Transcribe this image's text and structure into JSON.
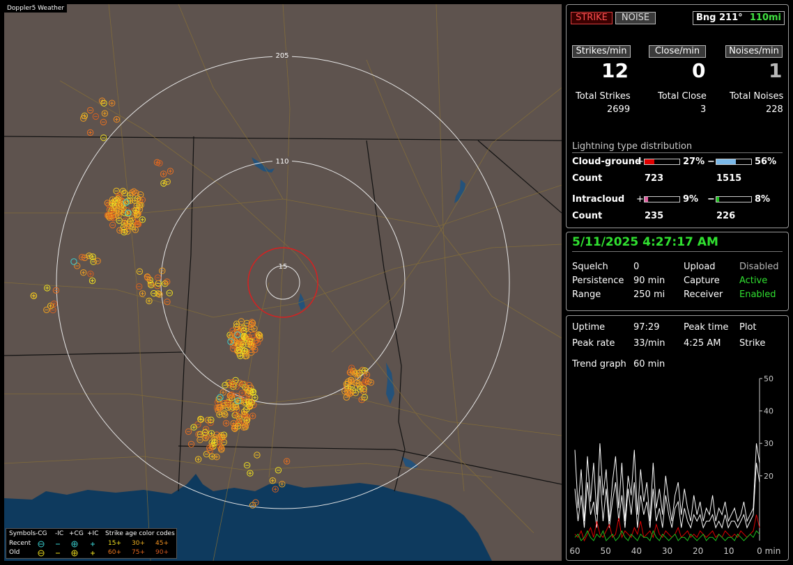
{
  "map": {
    "title": "Doppler5 Weather",
    "range_labels": [
      "205",
      "110",
      "15"
    ],
    "legend": {
      "symbols_label": "Symbols",
      "col_headers": [
        "-CG",
        "-IC",
        "+CG",
        "+IC"
      ],
      "rows": [
        "Recent",
        "Old"
      ],
      "age_title": "Strike age color codes",
      "age_codes": [
        [
          "15+",
          "30+",
          "45+"
        ],
        [
          "60+",
          "75+",
          "90+"
        ]
      ]
    }
  },
  "top": {
    "strike_label": "STRIKE",
    "noise_label": "NOISE",
    "bearing_label": "Bng 211°",
    "distance_label": "110mi",
    "strikes_min_label": "Strikes/min",
    "close_min_label": "Close/min",
    "noises_min_label": "Noises/min",
    "strikes_min": "12",
    "close_min": "0",
    "noises_min": "1",
    "total_strikes_label": "Total Strikes",
    "total_close_label": "Total Close",
    "total_noises_label": "Total Noises",
    "total_strikes": "2699",
    "total_close": "3",
    "total_noises": "228",
    "dist_title": "Lightning type distribution",
    "cg_label": "Cloud-ground",
    "ic_label": "Intracloud",
    "count_label": "Count",
    "plus": "+",
    "minus": "−",
    "cg_pos_pct": "27%",
    "cg_neg_pct": "56%",
    "cg_pos_count": "723",
    "cg_neg_count": "1515",
    "ic_pos_pct": "9%",
    "ic_neg_pct": "8%",
    "ic_pos_count": "235",
    "ic_neg_count": "226",
    "cg_pos_frac": 0.27,
    "cg_neg_frac": 0.56,
    "ic_pos_frac": 0.09,
    "ic_neg_frac": 0.08,
    "colors": {
      "cg_pos": "#e00000",
      "cg_neg": "#7ab8e8",
      "ic_pos": "#e060a0",
      "ic_neg": "#20c020"
    }
  },
  "status": {
    "datetime": "5/11/2025 4:27:17 AM",
    "squelch_label": "Squelch",
    "squelch": "0",
    "persistence_label": "Persistence",
    "persistence": "90 min",
    "range_label": "Range",
    "range": "250 mi",
    "upload_label": "Upload",
    "upload": "Disabled",
    "capture_label": "Capture",
    "capture": "Active",
    "receiver_label": "Receiver",
    "receiver": "Enabled"
  },
  "stats": {
    "uptime_label": "Uptime",
    "uptime": "97:29",
    "peak_time_label": "Peak time",
    "peak_time": "4:25 AM",
    "plot_label": "Plot",
    "plot": "Strike",
    "peak_rate_label": "Peak rate",
    "peak_rate": "33/min",
    "trend_label": "Trend graph",
    "trend": "60 min"
  },
  "chart_data": {
    "type": "line",
    "xlabel": "min",
    "x_ticks": [
      "60",
      "50",
      "40",
      "30",
      "20",
      "10",
      "0"
    ],
    "y_ticks": [
      "50",
      "40",
      "30",
      "20"
    ],
    "ylim": [
      0,
      50
    ],
    "xlim": [
      60,
      0
    ],
    "series": [
      {
        "color": "#ffffff",
        "values": [
          28,
          10,
          22,
          6,
          26,
          12,
          24,
          8,
          30,
          14,
          22,
          6,
          18,
          26,
          10,
          24,
          6,
          20,
          14,
          28,
          8,
          22,
          12,
          18,
          6,
          24,
          10,
          16,
          8,
          20,
          12,
          6,
          14,
          18,
          8,
          16,
          10,
          6,
          14,
          8,
          12,
          6,
          10,
          8,
          14,
          6,
          10,
          8,
          12,
          6,
          8,
          10,
          6,
          8,
          12,
          6,
          8,
          10,
          30,
          24
        ]
      },
      {
        "color": "#ffffff",
        "values": [
          16,
          6,
          14,
          4,
          18,
          8,
          12,
          4,
          20,
          6,
          16,
          4,
          12,
          18,
          6,
          14,
          4,
          16,
          8,
          18,
          4,
          14,
          8,
          12,
          4,
          16,
          6,
          10,
          4,
          14,
          8,
          4,
          10,
          12,
          4,
          10,
          6,
          4,
          8,
          6,
          8,
          4,
          6,
          6,
          8,
          4,
          6,
          4,
          8,
          4,
          6,
          6,
          4,
          6,
          8,
          4,
          6,
          8,
          24,
          18
        ]
      },
      {
        "color": "#e00000",
        "values": [
          2,
          1,
          3,
          0,
          2,
          4,
          1,
          6,
          2,
          1,
          3,
          5,
          1,
          2,
          7,
          1,
          3,
          2,
          1,
          4,
          2,
          6,
          1,
          2,
          3,
          1,
          5,
          2,
          1,
          3,
          2,
          1,
          2,
          4,
          1,
          2,
          3,
          1,
          2,
          1,
          3,
          2,
          1,
          2,
          3,
          1,
          2,
          1,
          3,
          2,
          1,
          2,
          1,
          3,
          2,
          1,
          2,
          3,
          8,
          4
        ]
      },
      {
        "color": "#20c020",
        "values": [
          1,
          2,
          0,
          1,
          3,
          1,
          0,
          2,
          1,
          3,
          0,
          1,
          2,
          0,
          1,
          3,
          1,
          0,
          2,
          1,
          0,
          2,
          1,
          1,
          0,
          3,
          1,
          0,
          2,
          1,
          0,
          1,
          2,
          0,
          1,
          1,
          0,
          2,
          1,
          0,
          1,
          2,
          0,
          1,
          1,
          0,
          2,
          1,
          0,
          1,
          1,
          0,
          2,
          1,
          0,
          1,
          2,
          1,
          3,
          2
        ]
      }
    ]
  }
}
